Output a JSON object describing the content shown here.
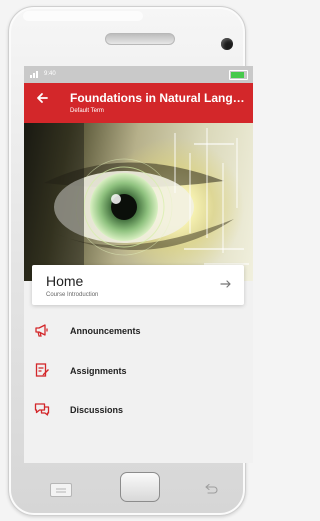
{
  "status_bar": {
    "left_text": "9:40",
    "right_text": ""
  },
  "app_bar": {
    "back_icon": "arrow-left-icon",
    "title": "Foundations in Natural Langu...",
    "subtitle": "Default Term",
    "color": "#d3272a"
  },
  "hero": {
    "description_icon": "eye-image"
  },
  "home_card": {
    "title": "Home",
    "subtitle": "Course Introduction",
    "arrow_icon": "arrow-right-icon"
  },
  "nav": {
    "items": [
      {
        "label": "Announcements",
        "icon": "megaphone-icon"
      },
      {
        "label": "Assignments",
        "icon": "assignment-icon"
      },
      {
        "label": "Discussions",
        "icon": "chat-icon"
      }
    ],
    "icon_color": "#d3272a"
  }
}
